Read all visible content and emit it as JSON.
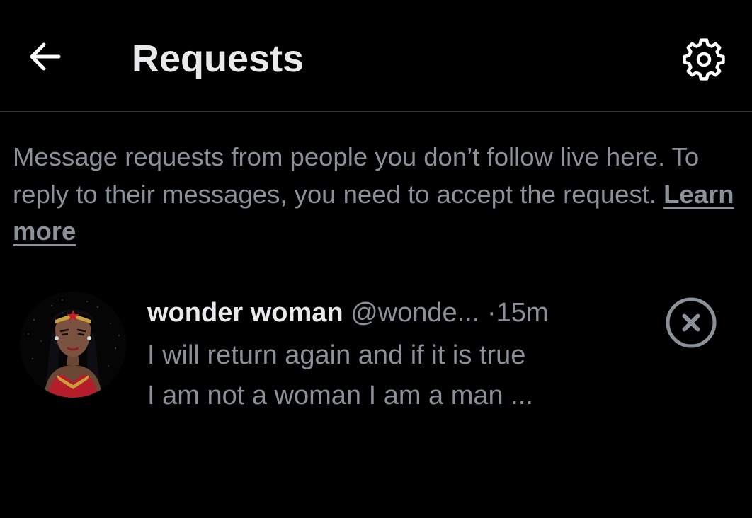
{
  "header": {
    "back_icon": "arrow-left-icon",
    "title": "Requests",
    "settings_icon": "gear-icon"
  },
  "info": {
    "text": "Message requests from people you don’t follow live here. To reply to their messages, you need to accept the request. ",
    "link_label": "Learn more"
  },
  "requests": [
    {
      "name": "wonder woman",
      "handle": "@wonde...",
      "separator": "·",
      "time": "15m",
      "message_lines": [
        "I will return again and if it is true",
        "I am not a woman I am a man ..."
      ],
      "avatar_icon": "wonder-woman-avatar",
      "dismiss_icon": "close-circle-icon"
    }
  ],
  "colors": {
    "background": "#000000",
    "primary_text": "#e7e9ea",
    "secondary_text": "#8b9199",
    "divider": "#2f3336"
  }
}
